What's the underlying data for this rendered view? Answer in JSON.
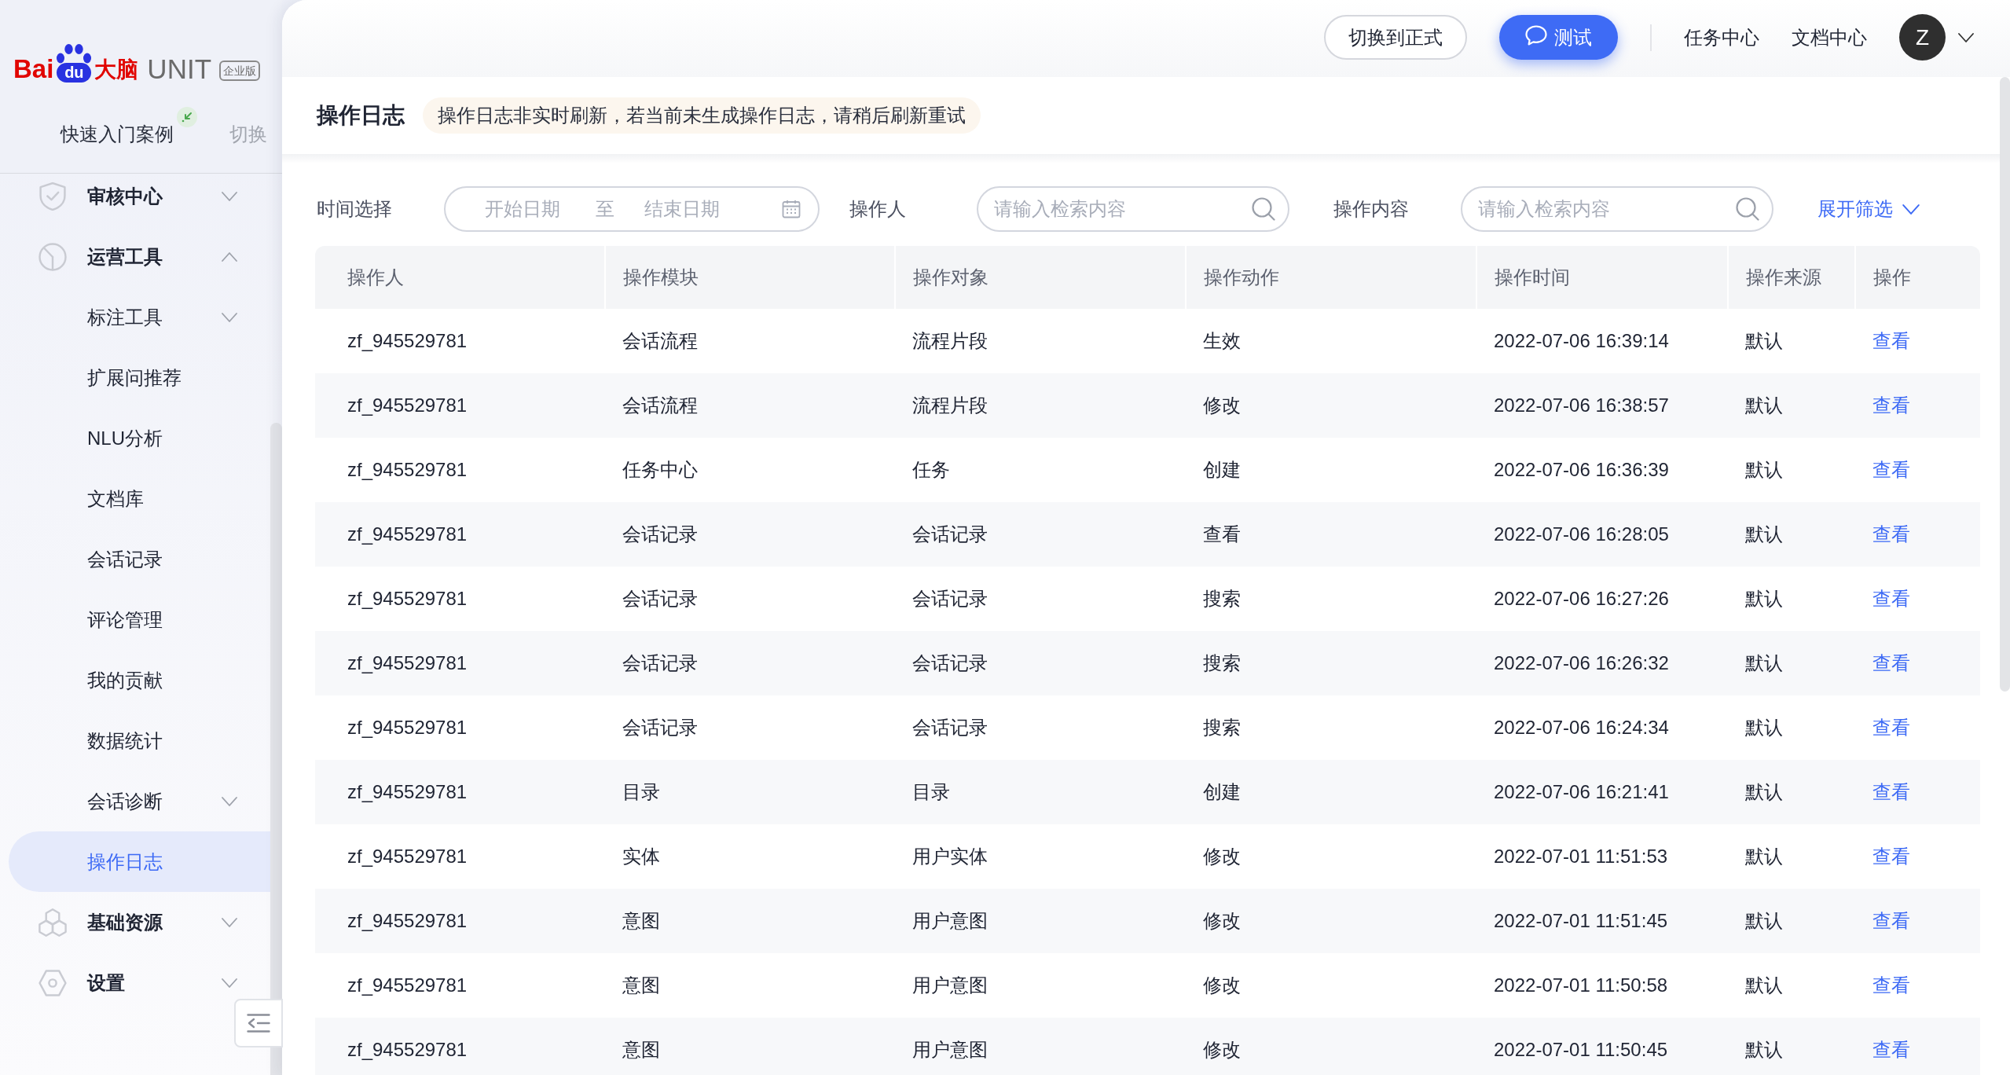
{
  "sidebar": {
    "logo": {
      "brand_prefix": "Bai",
      "paw_label": "du",
      "brand_cn": "大脑",
      "product": "UNIT",
      "edition_badge": "企业版"
    },
    "project": {
      "name": "快速入门案例",
      "switch_label": "切换"
    },
    "menu": [
      {
        "label": "审核中心",
        "expanded": false,
        "selected": false
      },
      {
        "label": "运营工具",
        "expanded": true,
        "selected": false,
        "children": [
          {
            "label": "标注工具",
            "expanded": false,
            "selected": false
          },
          {
            "label": "扩展问推荐",
            "selected": false
          },
          {
            "label": "NLU分析",
            "selected": false
          },
          {
            "label": "文档库",
            "selected": false
          },
          {
            "label": "会话记录",
            "selected": false
          },
          {
            "label": "评论管理",
            "selected": false
          },
          {
            "label": "我的贡献",
            "selected": false
          },
          {
            "label": "数据统计",
            "selected": false
          },
          {
            "label": "会话诊断",
            "expanded": false,
            "selected": false
          },
          {
            "label": "操作日志",
            "selected": true
          }
        ]
      },
      {
        "label": "基础资源",
        "expanded": false,
        "selected": false
      },
      {
        "label": "设置",
        "expanded": false,
        "selected": false
      }
    ]
  },
  "top_bar": {
    "buttons": [
      {
        "label": "切换到正式",
        "kind": "outline"
      },
      {
        "label": "测试",
        "kind": "primary"
      }
    ],
    "links": [
      "任务中心",
      "文档中心"
    ],
    "avatar": {
      "initial": "Z"
    }
  },
  "page": {
    "title": "操作日志",
    "notice": "操作日志非实时刷新，若当前未生成操作日志，请稍后刷新重试"
  },
  "filters": {
    "items": [
      {
        "kind": "date_range",
        "label": "时间选择",
        "start_placeholder": "开始日期",
        "separator": "至",
        "end_placeholder": "结束日期"
      },
      {
        "kind": "search",
        "label": "操作人",
        "placeholder": "请输入检索内容"
      },
      {
        "kind": "search",
        "label": "操作内容",
        "placeholder": "请输入检索内容"
      }
    ],
    "toggle": {
      "label": "展开筛选",
      "expanded": false
    }
  },
  "table": {
    "columns": [
      {
        "label": "操作人",
        "kind": "text"
      },
      {
        "label": "操作模块",
        "kind": "text"
      },
      {
        "label": "操作对象",
        "kind": "text"
      },
      {
        "label": "操作动作",
        "kind": "text"
      },
      {
        "label": "操作时间",
        "kind": "text"
      },
      {
        "label": "操作来源",
        "kind": "text"
      },
      {
        "label": "操作",
        "kind": "action"
      }
    ],
    "rows": [
      [
        "zf_945529781",
        "会话流程",
        "流程片段",
        "生效",
        "2022-07-06 16:39:14",
        "默认",
        "查看"
      ],
      [
        "zf_945529781",
        "会话流程",
        "流程片段",
        "修改",
        "2022-07-06 16:38:57",
        "默认",
        "查看"
      ],
      [
        "zf_945529781",
        "任务中心",
        "任务",
        "创建",
        "2022-07-06 16:36:39",
        "默认",
        "查看"
      ],
      [
        "zf_945529781",
        "会话记录",
        "会话记录",
        "查看",
        "2022-07-06 16:28:05",
        "默认",
        "查看"
      ],
      [
        "zf_945529781",
        "会话记录",
        "会话记录",
        "搜索",
        "2022-07-06 16:27:26",
        "默认",
        "查看"
      ],
      [
        "zf_945529781",
        "会话记录",
        "会话记录",
        "搜索",
        "2022-07-06 16:26:32",
        "默认",
        "查看"
      ],
      [
        "zf_945529781",
        "会话记录",
        "会话记录",
        "搜索",
        "2022-07-06 16:24:34",
        "默认",
        "查看"
      ],
      [
        "zf_945529781",
        "目录",
        "目录",
        "创建",
        "2022-07-06 16:21:41",
        "默认",
        "查看"
      ],
      [
        "zf_945529781",
        "实体",
        "用户实体",
        "修改",
        "2022-07-01 11:51:53",
        "默认",
        "查看"
      ],
      [
        "zf_945529781",
        "意图",
        "用户意图",
        "修改",
        "2022-07-01 11:51:45",
        "默认",
        "查看"
      ],
      [
        "zf_945529781",
        "意图",
        "用户意图",
        "修改",
        "2022-07-01 11:50:58",
        "默认",
        "查看"
      ],
      [
        "zf_945529781",
        "意图",
        "用户意图",
        "修改",
        "2022-07-01 11:50:45",
        "默认",
        "查看"
      ]
    ]
  }
}
